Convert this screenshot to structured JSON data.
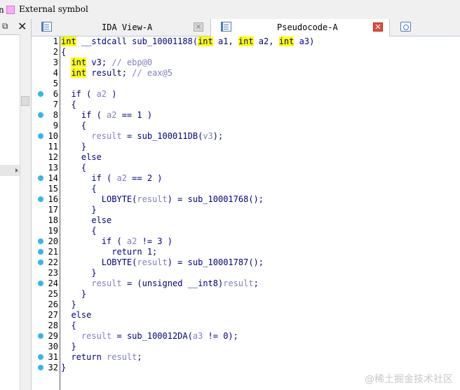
{
  "legend": {
    "edge_char": "n",
    "label": "External symbol",
    "swatch_color": "#ffaaff"
  },
  "left_panel": {
    "dock_icon": "dock-icon",
    "close_icon": "close-icon"
  },
  "tabs": [
    {
      "label": "IDA View-A",
      "icon": "ida-view-icon",
      "active": false
    },
    {
      "label": "Pseudocode-A",
      "icon": "pseudocode-icon",
      "active": true
    },
    {
      "label": "",
      "icon": "hex-view-icon",
      "active": false
    }
  ],
  "code_lines": [
    {
      "n": "1",
      "dot": false,
      "tokens": [
        [
          "hl",
          "int"
        ],
        [
          "pl",
          " __stdcall sub_10001188("
        ],
        [
          "hl",
          "int"
        ],
        [
          "pl",
          " a1, "
        ],
        [
          "hl",
          "int"
        ],
        [
          "pl",
          " a2, "
        ],
        [
          "hl",
          "int"
        ],
        [
          "pl",
          " a3)"
        ]
      ]
    },
    {
      "n": "2",
      "dot": false,
      "tokens": [
        [
          "pl",
          "{"
        ]
      ]
    },
    {
      "n": "3",
      "dot": false,
      "tokens": [
        [
          "pl",
          "  "
        ],
        [
          "hl",
          "int"
        ],
        [
          "pl",
          " v3; "
        ],
        [
          "cm",
          "// ebp@0"
        ]
      ]
    },
    {
      "n": "4",
      "dot": false,
      "tokens": [
        [
          "pl",
          "  "
        ],
        [
          "hl",
          "int"
        ],
        [
          "pl",
          " result; "
        ],
        [
          "cm",
          "// eax@5"
        ]
      ]
    },
    {
      "n": "5",
      "dot": false,
      "tokens": []
    },
    {
      "n": "6",
      "dot": true,
      "tokens": [
        [
          "pl",
          "  if ( "
        ],
        [
          "var",
          "a2"
        ],
        [
          "pl",
          " )"
        ]
      ]
    },
    {
      "n": "7",
      "dot": false,
      "tokens": [
        [
          "pl",
          "  {"
        ]
      ]
    },
    {
      "n": "8",
      "dot": true,
      "tokens": [
        [
          "pl",
          "    if ( "
        ],
        [
          "var",
          "a2"
        ],
        [
          "pl",
          " == 1 )"
        ]
      ]
    },
    {
      "n": "9",
      "dot": false,
      "tokens": [
        [
          "pl",
          "    {"
        ]
      ]
    },
    {
      "n": "10",
      "dot": true,
      "tokens": [
        [
          "pl",
          "      "
        ],
        [
          "var",
          "result"
        ],
        [
          "pl",
          " = sub_100011DB("
        ],
        [
          "var",
          "v3"
        ],
        [
          "pl",
          ");"
        ]
      ]
    },
    {
      "n": "11",
      "dot": false,
      "tokens": [
        [
          "pl",
          "    }"
        ]
      ]
    },
    {
      "n": "12",
      "dot": false,
      "tokens": [
        [
          "pl",
          "    else"
        ]
      ]
    },
    {
      "n": "13",
      "dot": false,
      "tokens": [
        [
          "pl",
          "    {"
        ]
      ]
    },
    {
      "n": "14",
      "dot": true,
      "tokens": [
        [
          "pl",
          "      if ( "
        ],
        [
          "var",
          "a2"
        ],
        [
          "pl",
          " == 2 )"
        ]
      ]
    },
    {
      "n": "15",
      "dot": false,
      "tokens": [
        [
          "pl",
          "      {"
        ]
      ]
    },
    {
      "n": "16",
      "dot": true,
      "tokens": [
        [
          "pl",
          "        LOBYTE("
        ],
        [
          "var",
          "result"
        ],
        [
          "pl",
          ") = sub_10001768();"
        ]
      ]
    },
    {
      "n": "17",
      "dot": false,
      "tokens": [
        [
          "pl",
          "      }"
        ]
      ]
    },
    {
      "n": "18",
      "dot": false,
      "tokens": [
        [
          "pl",
          "      else"
        ]
      ]
    },
    {
      "n": "19",
      "dot": false,
      "tokens": [
        [
          "pl",
          "      {"
        ]
      ]
    },
    {
      "n": "20",
      "dot": true,
      "tokens": [
        [
          "pl",
          "        if ( "
        ],
        [
          "var",
          "a2"
        ],
        [
          "pl",
          " != 3 )"
        ]
      ]
    },
    {
      "n": "21",
      "dot": true,
      "tokens": [
        [
          "pl",
          "          return 1;"
        ]
      ]
    },
    {
      "n": "22",
      "dot": true,
      "tokens": [
        [
          "pl",
          "        LOBYTE("
        ],
        [
          "var",
          "result"
        ],
        [
          "pl",
          ") = sub_10001787();"
        ]
      ]
    },
    {
      "n": "23",
      "dot": false,
      "tokens": [
        [
          "pl",
          "      }"
        ]
      ]
    },
    {
      "n": "24",
      "dot": true,
      "tokens": [
        [
          "pl",
          "      "
        ],
        [
          "var",
          "result"
        ],
        [
          "pl",
          " = (unsigned __int8)"
        ],
        [
          "var",
          "result"
        ],
        [
          "pl",
          ";"
        ]
      ]
    },
    {
      "n": "25",
      "dot": false,
      "tokens": [
        [
          "pl",
          "    }"
        ]
      ]
    },
    {
      "n": "26",
      "dot": false,
      "tokens": [
        [
          "pl",
          "  }"
        ]
      ]
    },
    {
      "n": "27",
      "dot": false,
      "tokens": [
        [
          "pl",
          "  else"
        ]
      ]
    },
    {
      "n": "28",
      "dot": false,
      "tokens": [
        [
          "pl",
          "  {"
        ]
      ]
    },
    {
      "n": "29",
      "dot": true,
      "tokens": [
        [
          "pl",
          "    "
        ],
        [
          "var",
          "result"
        ],
        [
          "pl",
          " = sub_100012DA("
        ],
        [
          "var",
          "a3"
        ],
        [
          "pl",
          " != 0);"
        ]
      ]
    },
    {
      "n": "30",
      "dot": false,
      "tokens": [
        [
          "pl",
          "  }"
        ]
      ]
    },
    {
      "n": "31",
      "dot": true,
      "tokens": [
        [
          "pl",
          "  return "
        ],
        [
          "var",
          "result"
        ],
        [
          "pl",
          ";"
        ]
      ]
    },
    {
      "n": "32",
      "dot": true,
      "tokens": [
        [
          "pl",
          "}"
        ]
      ]
    }
  ],
  "watermark": "@稀土掘金技术社区",
  "colors": {
    "highlight": "#ffff00",
    "keyword": "#000080",
    "variable": "#8080c0",
    "breakpoint_dot": "#37b4f0",
    "close_active": "#e84a3a"
  }
}
